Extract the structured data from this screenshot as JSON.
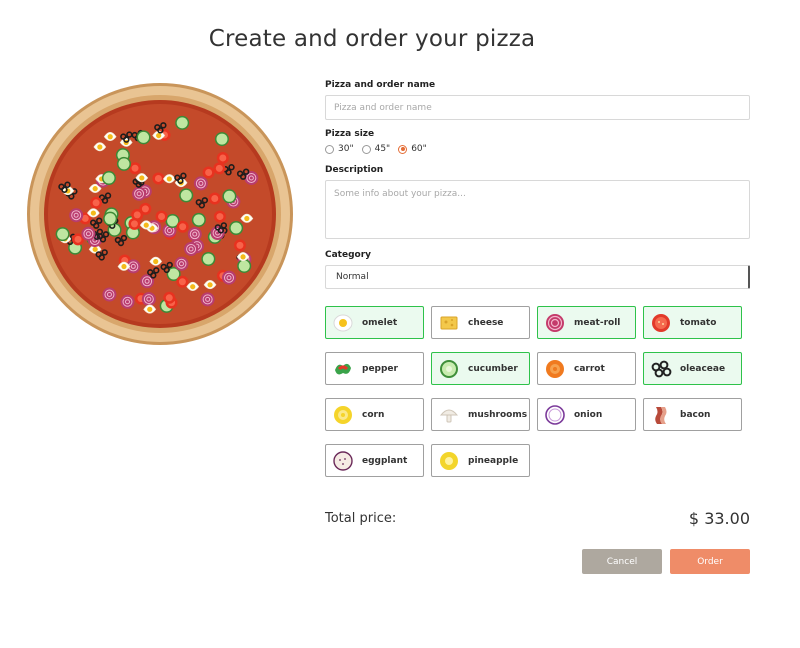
{
  "page": {
    "title": "Create and order your pizza"
  },
  "form": {
    "name_label": "Pizza and order name",
    "name_placeholder": "Pizza and order name",
    "name_value": "",
    "size_label": "Pizza size",
    "sizes": [
      {
        "label": "30\"",
        "checked": false
      },
      {
        "label": "45\"",
        "checked": false
      },
      {
        "label": "60\"",
        "checked": true
      }
    ],
    "description_label": "Description",
    "description_placeholder": "Some info about your pizza...",
    "category_label": "Category",
    "category_value": "Normal"
  },
  "ingredients": [
    {
      "label": "omelet",
      "icon": "omelet-icon",
      "selected": true
    },
    {
      "label": "cheese",
      "icon": "cheese-icon",
      "selected": false
    },
    {
      "label": "meat-roll",
      "icon": "meat-roll-icon",
      "selected": true
    },
    {
      "label": "tomato",
      "icon": "tomato-icon",
      "selected": true
    },
    {
      "label": "pepper",
      "icon": "pepper-icon",
      "selected": false
    },
    {
      "label": "cucumber",
      "icon": "cucumber-icon",
      "selected": true
    },
    {
      "label": "carrot",
      "icon": "carrot-icon",
      "selected": false
    },
    {
      "label": "oleaceae",
      "icon": "olives-icon",
      "selected": true
    },
    {
      "label": "corn",
      "icon": "corn-icon",
      "selected": false
    },
    {
      "label": "mushrooms",
      "icon": "mushroom-icon",
      "selected": false
    },
    {
      "label": "onion",
      "icon": "onion-icon",
      "selected": false
    },
    {
      "label": "bacon",
      "icon": "bacon-icon",
      "selected": false
    },
    {
      "label": "eggplant",
      "icon": "eggplant-icon",
      "selected": false
    },
    {
      "label": "pineapple",
      "icon": "pineapple-icon",
      "selected": false
    }
  ],
  "total": {
    "label": "Total price:",
    "value": "$ 33.00"
  },
  "actions": {
    "cancel": "Cancel",
    "order": "Order"
  },
  "colors": {
    "accent": "#e46d36",
    "selected_border": "#2ec24a",
    "selected_bg": "#ebfaef",
    "cancel_bg": "#aea89f",
    "order_bg": "#ef8c68"
  }
}
